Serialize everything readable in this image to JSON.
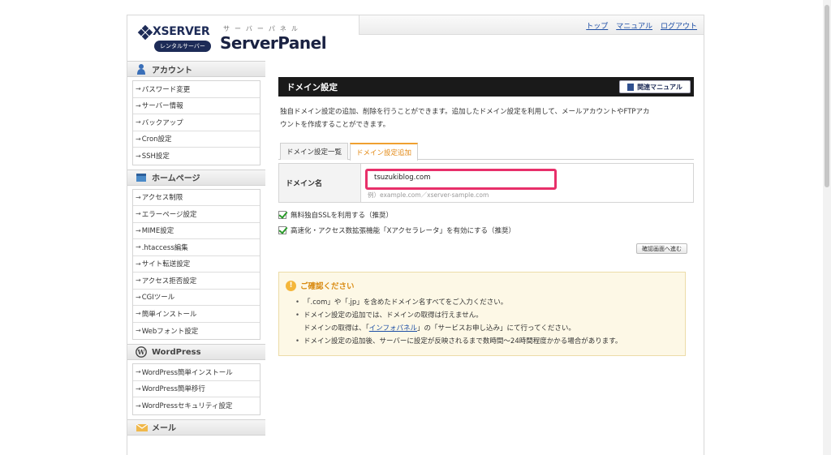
{
  "header": {
    "logo_text": "XSERVER",
    "logo_sub": "レンタルサーバー",
    "panel_kana": "サーバーパネル",
    "panel_title": "ServerPanel",
    "links": [
      "トップ",
      "マニュアル",
      "ログアウト"
    ]
  },
  "sidebar": {
    "sections": [
      {
        "title": "アカウント",
        "icon": "user-icon",
        "items": [
          "パスワード変更",
          "サーバー情報",
          "バックアップ",
          "Cron設定",
          "SSH設定"
        ]
      },
      {
        "title": "ホームページ",
        "icon": "homepage-icon",
        "items": [
          "アクセス制限",
          "エラーページ設定",
          "MIME設定",
          ".htaccess編集",
          "サイト転送設定",
          "アクセス拒否設定",
          "CGIツール",
          "簡単インストール",
          "Webフォント設定"
        ]
      },
      {
        "title": "WordPress",
        "icon": "wordpress-icon",
        "items": [
          "WordPress簡単インストール",
          "WordPress簡単移行",
          "WordPressセキュリティ設定"
        ]
      },
      {
        "title": "メール",
        "icon": "mail-icon",
        "items": []
      }
    ]
  },
  "main": {
    "title": "ドメイン設定",
    "manual_button": "関連マニュアル",
    "description_line1": "独自ドメイン設定の追加、削除を行うことができます。追加したドメイン設定を利用して、メールアカウントやFTPアカ",
    "description_line2": "ウントを作成することができます。",
    "tabs": [
      "ドメイン設定一覧",
      "ドメイン設定追加"
    ],
    "active_tab": 1,
    "domain_label": "ドメイン名",
    "domain_value": "tsuzukiblog.com",
    "domain_example": "例）example.com／xserver-sample.com",
    "checkbox_ssl": "無料独自SSLを利用する（推奨）",
    "checkbox_accel": "高速化・アクセス数拡張機能「Xアクセラレータ」を有効にする（推奨）",
    "confirm_button": "確認画面へ進む",
    "notice": {
      "title": "ご確認ください",
      "item1": "「.com」や「.jp」を含めたドメイン名すべてをご入力ください。",
      "item2": "ドメイン設定の追加では、ドメインの取得は行えません。",
      "item3_pre": "ドメインの取得は、「",
      "item3_link": "インフォパネル",
      "item3_post": "」の「サービスお申し込み」にて行ってください。",
      "item4": "ドメイン設定の追加後、サーバーに設定が反映されるまで数時間〜24時間程度かかる場合があります。"
    }
  }
}
